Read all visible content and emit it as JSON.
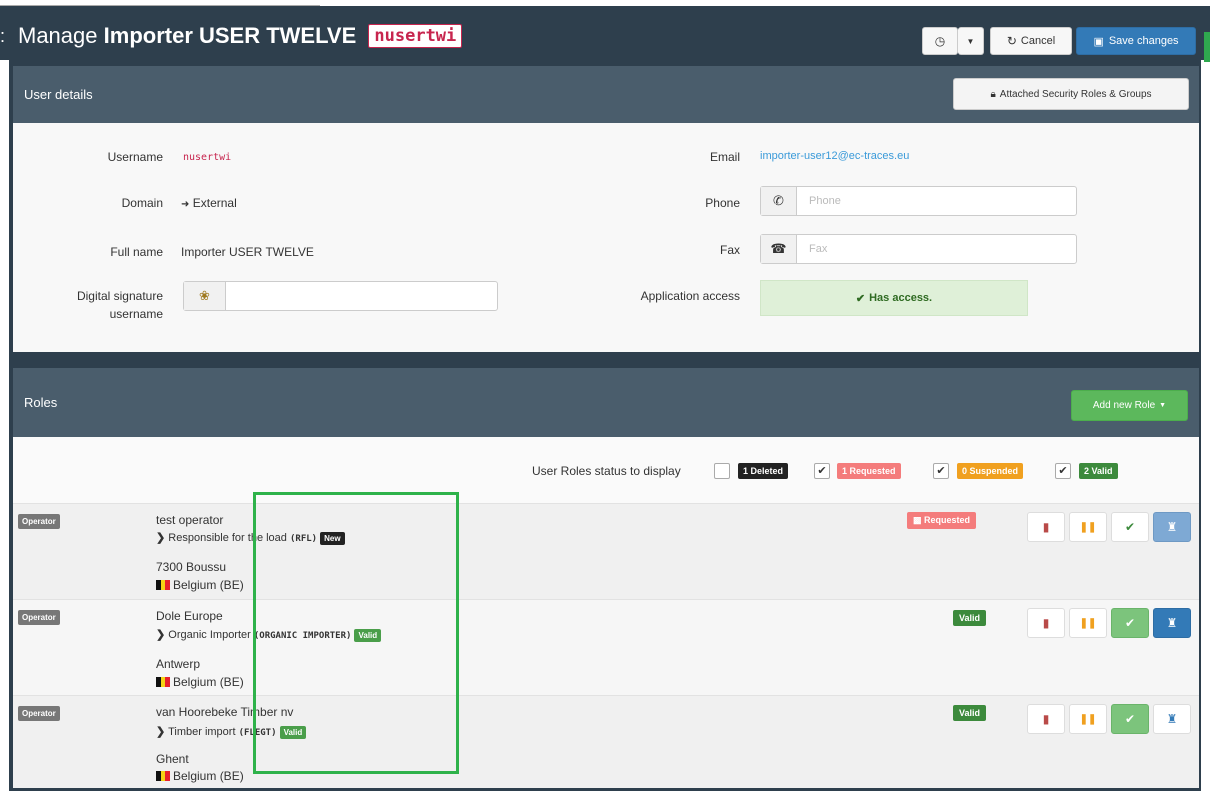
{
  "header": {
    "title_prefix": "Manage",
    "title_name": "Importer USER TWELVE",
    "title_code": "nusertwi",
    "history_icon": "history-icon",
    "cancel_label": "Cancel",
    "save_label": "Save changes"
  },
  "user_details": {
    "heading": "User details",
    "security_button": "Attached Security Roles & Groups",
    "username_label": "Username",
    "username_value": "nusertwi",
    "domain_label": "Domain",
    "domain_value": "External",
    "fullname_label": "Full name",
    "fullname_value": "Importer USER TWELVE",
    "digsig_label_1": "Digital signature",
    "digsig_label_2": "username",
    "digsig_value": "",
    "email_label": "Email",
    "email_value": "importer-user12@ec-traces.eu",
    "phone_label": "Phone",
    "phone_placeholder": "Phone",
    "fax_label": "Fax",
    "fax_placeholder": "Fax",
    "access_label": "Application access",
    "access_value": "Has access."
  },
  "roles": {
    "heading": "Roles",
    "add_button": "Add new Role",
    "filter_label": "User Roles status to display",
    "filters": [
      {
        "label": "1 Deleted",
        "checked": false,
        "color": "#222222"
      },
      {
        "label": "1 Requested",
        "checked": true,
        "color": "#f47c7c"
      },
      {
        "label": "0 Suspended",
        "checked": true,
        "color": "#f0a01f"
      },
      {
        "label": "2 Valid",
        "checked": true,
        "color": "#3c8a3c"
      }
    ],
    "items": [
      {
        "type": "Operator",
        "name": "test operator",
        "role_text": "Responsible for the load",
        "role_code": "(RFL)",
        "role_badge": "New",
        "city": "7300 Boussu",
        "country": "Belgium (BE)",
        "status": "Requested"
      },
      {
        "type": "Operator",
        "name": "Dole Europe",
        "role_text": "Organic Importer",
        "role_code": "(ORGANIC IMPORTER)",
        "role_badge": "Valid",
        "city": "Antwerp",
        "country": "Belgium (BE)",
        "status": "Valid"
      },
      {
        "type": "Operator",
        "name": "van Hoorebeke Timber nv",
        "role_text": "Timber import",
        "role_code": "(FLEGT)",
        "role_badge": "Valid",
        "city": "Ghent",
        "country": "Belgium (BE)",
        "status": "Valid"
      }
    ]
  },
  "colors": {
    "header_bg": "#2e3f4d",
    "panel_head_bg": "#4a5d6c",
    "primary": "#337ab7",
    "success": "#5cb85c",
    "highlight_box": "#2eb24a"
  }
}
